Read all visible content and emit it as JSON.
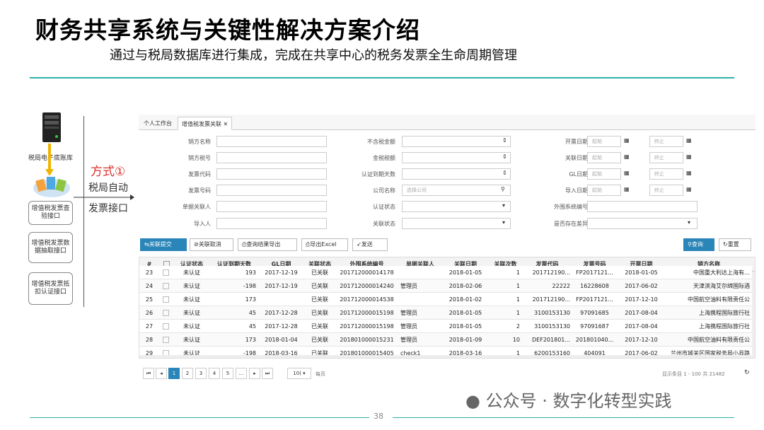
{
  "slide": {
    "title": "财务共享系统与关键性解决方案介绍",
    "subtitle": "通过与税局数据库进行集成，完成在共享中心的税务发票全生命周期管理",
    "page_number": "38",
    "watermark": "公众号 · 数字化转型实践"
  },
  "diagram": {
    "server_label": "税局电子底账库",
    "boxes": [
      "增值税发票查验接口",
      "增值税发票数据抽取接口",
      "增值税发票抵扣认证接口"
    ],
    "mode_label": "方式①",
    "auto_line1": "税局自动",
    "auto_line2": "发票接口",
    "mode_color": "#d9312b"
  },
  "app": {
    "tabs": [
      "个人工作台",
      "增值税发票关联"
    ],
    "filters": {
      "col1": [
        "销方名称",
        "销方税号",
        "发票代码",
        "发票号码",
        "单据关联人",
        "导入人"
      ],
      "col2": [
        "不含税金额",
        "金税税额",
        "认证到期天数",
        "公司名称",
        "认证状态",
        "关联状态"
      ],
      "col3": [
        "开票日期",
        "关联日期",
        "GL日期",
        "导入日期",
        "外围系统编号",
        "是否存在差异"
      ],
      "company_placeholder": "选择公司",
      "start_placeholder": "起始",
      "end_placeholder": "终止"
    },
    "toolbar": {
      "link_submit": "关联提交",
      "link_cancel": "关联取消",
      "export_query": "查询结果导出",
      "export_excel": "导出Excel",
      "send": "发送",
      "query": "查询",
      "reset": "重置"
    },
    "columns": [
      "#",
      "",
      "认证状态",
      "认证到期天数",
      "GL日期",
      "关联状态",
      "外围系统编号",
      "单据关联人",
      "关联日期",
      "关联次数",
      "发票代码",
      "发票号码",
      "开票日期",
      "销方名称"
    ],
    "rows": [
      [
        "23",
        "未认证",
        "193",
        "2017-12-19",
        "已关联",
        "201712000014178",
        "",
        "2018-01-05",
        "1",
        "201712190...",
        "FP2017121...",
        "2018-01-05",
        "中国重大利达上海有…"
      ],
      [
        "24",
        "未认证",
        "-198",
        "2017-12-19",
        "已关联",
        "201712000014240",
        "管理员",
        "2018-02-06",
        "1",
        "22222",
        "16228608",
        "2017-06-02",
        "天津滨海艾尔缔国际酒"
      ],
      [
        "25",
        "未认证",
        "173",
        "",
        "已关联",
        "201712000014538",
        "",
        "2018-01-02",
        "1",
        "201712190...",
        "FP2017121...",
        "2017-12-10",
        "中国航空油料有限责任公"
      ],
      [
        "26",
        "未认证",
        "45",
        "2017-12-28",
        "已关联",
        "201712000015198",
        "管理员",
        "2018-01-05",
        "1",
        "3100153130",
        "97091685",
        "2017-08-04",
        "上海携程国际旅行社"
      ],
      [
        "27",
        "未认证",
        "45",
        "2017-12-28",
        "已关联",
        "201712000015198",
        "管理员",
        "2018-01-05",
        "2",
        "3100153130",
        "97091687",
        "2017-08-04",
        "上海携程国际旅行社"
      ],
      [
        "28",
        "未认证",
        "173",
        "2018-01-04",
        "已关联",
        "201801000015231",
        "管理员",
        "2018-01-09",
        "10",
        "DEF201801...",
        "201801040...",
        "2017-12-10",
        "中国航空油料有限责任公"
      ],
      [
        "29",
        "未认证",
        "-198",
        "2018-03-16",
        "已关联",
        "201801000015405",
        "check1",
        "2018-03-16",
        "1",
        "6200153160",
        "404091",
        "2017-06-02",
        "兰州市城关区国家税务局小县路"
      ]
    ],
    "pager": {
      "first": "⏮",
      "prev": "◂",
      "pages": [
        "1",
        "2",
        "3",
        "4",
        "5",
        "..."
      ],
      "next": "▸",
      "last": "⏭",
      "page_size": "10(",
      "per_page": "每页",
      "summary": "显示条目 1 - 100 共 21482"
    }
  }
}
